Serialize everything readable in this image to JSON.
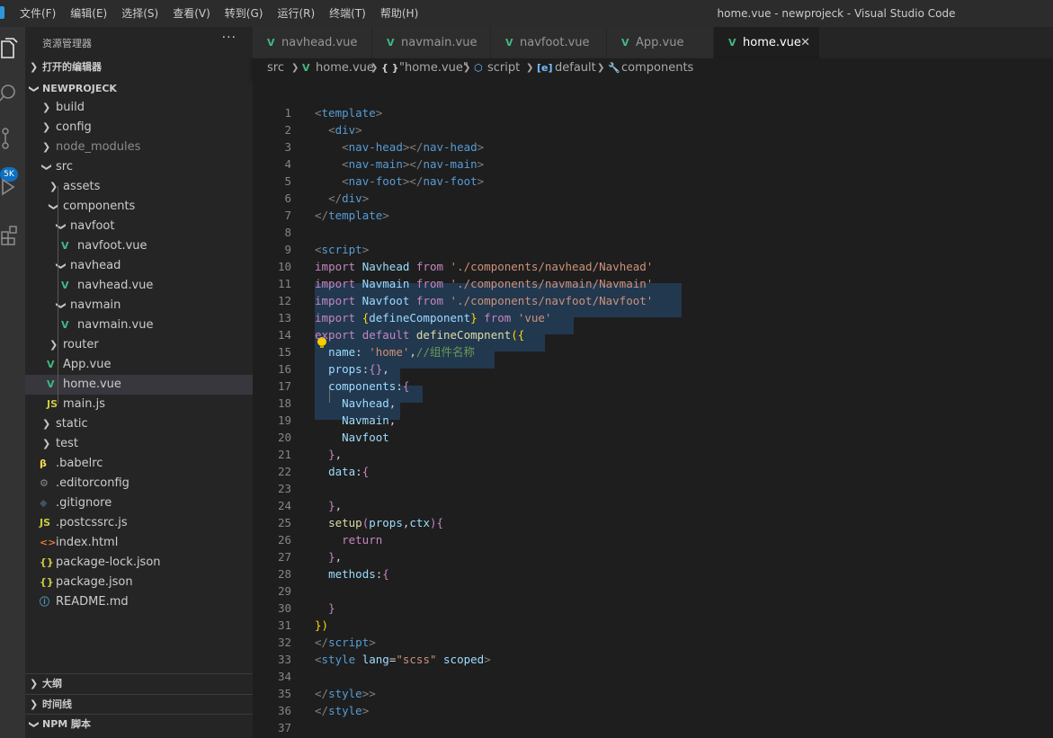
{
  "menu": [
    "文件(F)",
    "编辑(E)",
    "选择(S)",
    "查看(V)",
    "转到(G)",
    "运行(R)",
    "终端(T)",
    "帮助(H)"
  ],
  "window_title": "home.vue - newprojeck - Visual Studio Code",
  "activity": {
    "badge": "5K"
  },
  "explorer": {
    "title": "资源管理器",
    "more": "···",
    "open_editors": "打开的编辑器",
    "project": "NEWPROJECK",
    "tree": [
      {
        "label": "build",
        "type": "folder",
        "depth": 0,
        "open": false
      },
      {
        "label": "config",
        "type": "folder",
        "depth": 0,
        "open": false
      },
      {
        "label": "node_modules",
        "type": "folder",
        "depth": 0,
        "open": false,
        "dim": true
      },
      {
        "label": "src",
        "type": "folder",
        "depth": 0,
        "open": true
      },
      {
        "label": "assets",
        "type": "folder",
        "depth": 1,
        "open": false
      },
      {
        "label": "components",
        "type": "folder",
        "depth": 1,
        "open": true
      },
      {
        "label": "navfoot",
        "type": "folder",
        "depth": 2,
        "open": true
      },
      {
        "label": "navfoot.vue",
        "type": "vue",
        "depth": 3
      },
      {
        "label": "navhead",
        "type": "folder",
        "depth": 2,
        "open": true
      },
      {
        "label": "navhead.vue",
        "type": "vue",
        "depth": 3
      },
      {
        "label": "navmain",
        "type": "folder",
        "depth": 2,
        "open": true
      },
      {
        "label": "navmain.vue",
        "type": "vue",
        "depth": 3
      },
      {
        "label": "router",
        "type": "folder",
        "depth": 1,
        "open": false
      },
      {
        "label": "App.vue",
        "type": "vue",
        "depth": 1
      },
      {
        "label": "home.vue",
        "type": "vue",
        "depth": 1,
        "selected": true
      },
      {
        "label": "main.js",
        "type": "js",
        "depth": 1
      },
      {
        "label": "static",
        "type": "folder",
        "depth": 0,
        "open": false
      },
      {
        "label": "test",
        "type": "folder",
        "depth": 0,
        "open": false
      },
      {
        "label": ".babelrc",
        "type": "babel",
        "depth": 0
      },
      {
        "label": ".editorconfig",
        "type": "gear",
        "depth": 0
      },
      {
        "label": ".gitignore",
        "type": "git",
        "depth": 0
      },
      {
        "label": ".postcssrc.js",
        "type": "js",
        "depth": 0
      },
      {
        "label": "index.html",
        "type": "html",
        "depth": 0
      },
      {
        "label": "package-lock.json",
        "type": "json",
        "depth": 0
      },
      {
        "label": "package.json",
        "type": "json",
        "depth": 0
      },
      {
        "label": "README.md",
        "type": "info",
        "depth": 0
      }
    ],
    "outline": "大纲",
    "timeline": "时间线",
    "npm": "NPM 脚本"
  },
  "tabs": [
    {
      "label": "navhead.vue",
      "active": false
    },
    {
      "label": "navmain.vue",
      "active": false
    },
    {
      "label": "navfoot.vue",
      "active": false
    },
    {
      "label": "App.vue",
      "active": false
    },
    {
      "label": "home.vue",
      "active": true
    }
  ],
  "breadcrumb": [
    {
      "icon": "",
      "label": "src"
    },
    {
      "icon": "vue-icon",
      "label": "home.vue"
    },
    {
      "icon": "braces-icon",
      "label": "\"home.vue\""
    },
    {
      "icon": "cube-icon",
      "label": "script"
    },
    {
      "icon": "field-icon",
      "label": "default"
    },
    {
      "icon": "wrench-icon",
      "label": "components"
    }
  ],
  "colors": {
    "vue": "#41b883",
    "accent": "#0e70c0",
    "js": "#cbcb41",
    "html": "#e37933",
    "json": "#cbcb41",
    "info": "#519aba",
    "selection": "#264f78"
  },
  "code_lines": [
    [
      [
        "<",
        "c-bracket"
      ],
      [
        "template",
        "c-tag"
      ],
      [
        ">",
        "c-bracket"
      ]
    ],
    [
      [
        "  ",
        ""
      ],
      [
        "<",
        "c-bracket"
      ],
      [
        "div",
        "c-tag"
      ],
      [
        ">",
        "c-bracket"
      ]
    ],
    [
      [
        "    ",
        ""
      ],
      [
        "<",
        "c-bracket"
      ],
      [
        "nav-head",
        "c-tag"
      ],
      [
        "></",
        "c-bracket"
      ],
      [
        "nav-head",
        "c-tag"
      ],
      [
        ">",
        "c-bracket"
      ]
    ],
    [
      [
        "    ",
        ""
      ],
      [
        "<",
        "c-bracket"
      ],
      [
        "nav-main",
        "c-tag"
      ],
      [
        "></",
        "c-bracket"
      ],
      [
        "nav-main",
        "c-tag"
      ],
      [
        ">",
        "c-bracket"
      ]
    ],
    [
      [
        "    ",
        ""
      ],
      [
        "<",
        "c-bracket"
      ],
      [
        "nav-foot",
        "c-tag"
      ],
      [
        "></",
        "c-bracket"
      ],
      [
        "nav-foot",
        "c-tag"
      ],
      [
        ">",
        "c-bracket"
      ]
    ],
    [
      [
        "  ",
        ""
      ],
      [
        "</",
        "c-bracket"
      ],
      [
        "div",
        "c-tag"
      ],
      [
        ">",
        "c-bracket"
      ]
    ],
    [
      [
        "</",
        "c-bracket"
      ],
      [
        "template",
        "c-tag"
      ],
      [
        ">",
        "c-bracket"
      ]
    ],
    [],
    [
      [
        "<",
        "c-bracket"
      ],
      [
        "script",
        "c-tag"
      ],
      [
        ">",
        "c-bracket"
      ]
    ],
    [
      [
        "im",
        "c-kw"
      ],
      [
        "port",
        "c-kw"
      ],
      [
        " Navhead ",
        "c-var"
      ],
      [
        "from",
        "c-kw"
      ],
      [
        " ",
        ""
      ],
      [
        "'./components/navhead/Navhead'",
        "c-str"
      ]
    ],
    [
      [
        "import",
        "c-kw"
      ],
      [
        " Navmain ",
        "c-var"
      ],
      [
        "from",
        "c-kw"
      ],
      [
        " ",
        ""
      ],
      [
        "'./components/navmain/Navmain'",
        "c-str"
      ]
    ],
    [
      [
        "import",
        "c-kw"
      ],
      [
        " Navfoot ",
        "c-var"
      ],
      [
        "from",
        "c-kw"
      ],
      [
        " ",
        ""
      ],
      [
        "'./components/navfoot/Navfoot'",
        "c-str"
      ]
    ],
    [
      [
        "import",
        "c-kw"
      ],
      [
        " ",
        ""
      ],
      [
        "{",
        "c-gold"
      ],
      [
        "defineComponent",
        "c-var"
      ],
      [
        "}",
        "c-gold"
      ],
      [
        " ",
        ""
      ],
      [
        "from",
        "c-kw"
      ],
      [
        " ",
        ""
      ],
      [
        "'vue'",
        "c-str"
      ]
    ],
    [
      [
        "export",
        "c-kw"
      ],
      [
        " ",
        ""
      ],
      [
        "default",
        "c-kw"
      ],
      [
        " ",
        ""
      ],
      [
        "defineCompnent",
        "c-fn"
      ],
      [
        "({",
        "c-gold"
      ]
    ],
    [
      [
        "  ",
        ""
      ],
      [
        "name",
        "c-var"
      ],
      [
        ": ",
        ""
      ],
      [
        "'home'",
        "c-str"
      ],
      [
        ",",
        ""
      ],
      [
        "//组件名称",
        "c-cm"
      ]
    ],
    [
      [
        "  ",
        ""
      ],
      [
        "props",
        "c-var"
      ],
      [
        ":",
        ""
      ],
      [
        "{}",
        "c-kw"
      ],
      [
        ",",
        ""
      ]
    ],
    [
      [
        "  ",
        ""
      ],
      [
        "components",
        "c-var"
      ],
      [
        ":",
        ""
      ],
      [
        "{",
        "c-kw"
      ]
    ],
    [
      [
        "    ",
        ""
      ],
      [
        "Navhead",
        "c-var"
      ],
      [
        ",",
        ""
      ]
    ],
    [
      [
        "    ",
        ""
      ],
      [
        "Navmain",
        "c-var"
      ],
      [
        ",",
        ""
      ]
    ],
    [
      [
        "    ",
        ""
      ],
      [
        "Navfoot",
        "c-var"
      ]
    ],
    [
      [
        "  ",
        ""
      ],
      [
        "}",
        "c-kw"
      ],
      [
        ",",
        ""
      ]
    ],
    [
      [
        "  ",
        ""
      ],
      [
        "data",
        "c-var"
      ],
      [
        ":",
        ""
      ],
      [
        "{",
        "c-kw"
      ]
    ],
    [],
    [
      [
        "  ",
        ""
      ],
      [
        "}",
        "c-kw"
      ],
      [
        ",",
        ""
      ]
    ],
    [
      [
        "  ",
        ""
      ],
      [
        "setup",
        "c-fn"
      ],
      [
        "(",
        "c-kw"
      ],
      [
        "props",
        "c-var"
      ],
      [
        ",",
        ""
      ],
      [
        "ctx",
        "c-var"
      ],
      [
        ")",
        "c-kw"
      ],
      [
        "{",
        "c-kw"
      ]
    ],
    [
      [
        "    ",
        ""
      ],
      [
        "return",
        "c-kw"
      ]
    ],
    [
      [
        "  ",
        ""
      ],
      [
        "}",
        "c-kw"
      ],
      [
        ",",
        ""
      ]
    ],
    [
      [
        "  ",
        ""
      ],
      [
        "methods",
        "c-var"
      ],
      [
        ":",
        ""
      ],
      [
        "{",
        "c-kw"
      ]
    ],
    [],
    [
      [
        "  ",
        ""
      ],
      [
        "}",
        "c-kw"
      ]
    ],
    [
      [
        "})",
        "c-gold"
      ]
    ],
    [
      [
        "</",
        "c-bracket"
      ],
      [
        "script",
        "c-tag"
      ],
      [
        ">",
        "c-bracket"
      ]
    ],
    [
      [
        "<",
        "c-bracket"
      ],
      [
        "style",
        "c-tag"
      ],
      [
        " ",
        ""
      ],
      [
        "lang",
        "c-var"
      ],
      [
        "=",
        ""
      ],
      [
        "\"scss\"",
        "c-str"
      ],
      [
        " ",
        ""
      ],
      [
        "scoped",
        "c-var"
      ],
      [
        ">",
        "c-bracket"
      ]
    ],
    [],
    [
      [
        "</",
        "c-bracket"
      ],
      [
        "style",
        "c-tag"
      ],
      [
        ">>",
        "c-bracket"
      ]
    ],
    [
      [
        "</",
        "c-bracket"
      ],
      [
        "style",
        "c-tag"
      ],
      [
        ">",
        "c-bracket"
      ]
    ],
    []
  ]
}
